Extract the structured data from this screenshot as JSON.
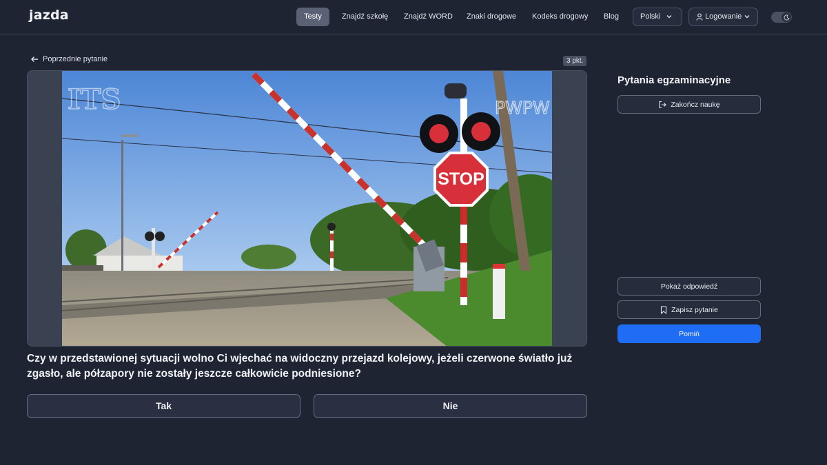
{
  "header": {
    "logo": "jazda",
    "nav": [
      {
        "label": "Testy",
        "active": true
      },
      {
        "label": "Znajdź szkołę",
        "active": false
      },
      {
        "label": "Znajdź WORD",
        "active": false
      },
      {
        "label": "Znaki drogowe",
        "active": false
      },
      {
        "label": "Kodeks drogowy",
        "active": false
      },
      {
        "label": "Blog",
        "active": false
      }
    ],
    "language": "Polski",
    "login": "Logowanie",
    "theme_icon": "moon-icon"
  },
  "question_panel": {
    "back_link": "Poprzednie pytanie",
    "points": "3 pkt.",
    "media": {
      "watermark_left": "ITS",
      "watermark_right": "PWPW",
      "sign_text": "STOP"
    },
    "question_text": "Czy w przedstawionej sytuacji wolno Ci wjechać na widoczny przejazd kolejowy, jeżeli czerwone światło już zgasło, ale półzapory nie zostały jeszcze całkowicie podniesione?",
    "answers": [
      "Tak",
      "Nie"
    ]
  },
  "sidebar": {
    "title": "Pytania egzaminacyjne",
    "end_button": "Zakończ naukę",
    "show_answer_button": "Pokaż odpowiedź",
    "save_button": "Zapisz pytanie",
    "skip_button": "Pomiń",
    "accent_color": "#1f6df5"
  }
}
